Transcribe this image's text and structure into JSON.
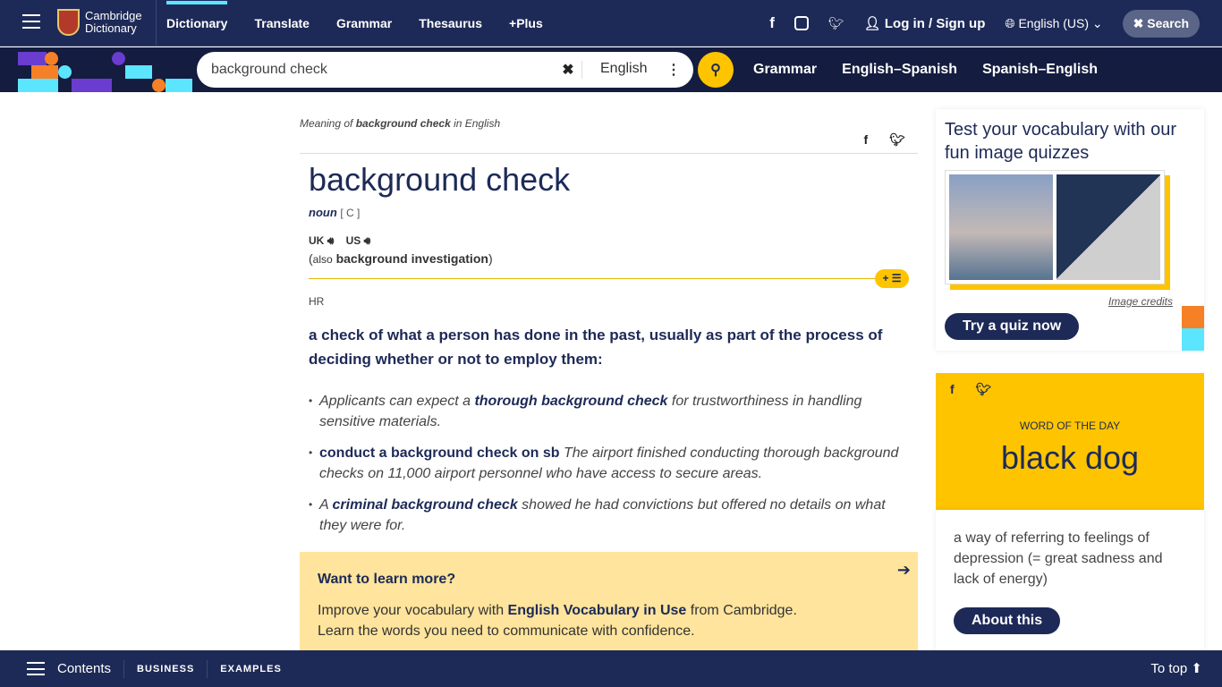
{
  "header": {
    "logo_line1": "Cambridge",
    "logo_line2": "Dictionary",
    "nav": [
      "Dictionary",
      "Translate",
      "Grammar",
      "Thesaurus",
      "+Plus"
    ],
    "login": "Log in / Sign up",
    "language": "English (US)",
    "search_button": "Search"
  },
  "search": {
    "value": "background check",
    "dictionary": "English",
    "links": [
      "Grammar",
      "English–Spanish",
      "Spanish–English"
    ]
  },
  "entry": {
    "meaning_prefix": "Meaning of ",
    "meaning_word": "background check",
    "meaning_suffix": " in English",
    "headword": "background check",
    "pos": "noun",
    "grammar": "[ C ]",
    "uk": "UK",
    "us": "US",
    "also_label": "also",
    "also_word": "background investigation",
    "domain": "HR",
    "definition": "a check of what a person has done in the past, usually as part of the process of deciding whether or not to employ them:",
    "examples": [
      {
        "a": "Applicants can expect a ",
        "b": "thorough background check",
        "c": " for trustworthiness in handling sensitive materials."
      },
      {
        "a": "",
        "b": "conduct a background check on sb",
        "c": " The airport finished conducting thorough background checks on 11,000 airport personnel who have access to secure areas."
      },
      {
        "a": "A ",
        "b": "criminal background check",
        "c": " showed he had convictions but offered no details on what they were for."
      }
    ]
  },
  "learn": {
    "title": "Want to learn more?",
    "p1a": "Improve your vocabulary with ",
    "p1b": "English Vocabulary in Use",
    "p1c": " from Cambridge.",
    "p2": "Learn the words you need to communicate with confidence."
  },
  "quiz": {
    "title": "Test your vocabulary with our fun image quizzes",
    "credits": "Image credits",
    "button": "Try a quiz now"
  },
  "wotd": {
    "label": "WORD OF THE DAY",
    "word": "black dog",
    "definition": "a way of referring to feelings of depression (= great sadness and lack of energy)",
    "button": "About this"
  },
  "footer": {
    "contents": "Contents",
    "items": [
      "BUSINESS",
      "EXAMPLES"
    ],
    "to_top": "To top"
  },
  "colors": {
    "navy": "#1d2a57",
    "yellow": "#fec400",
    "light_yellow": "#fee49c",
    "cyan": "#5be5ff",
    "orange": "#f58025",
    "purple": "#6a3ccf"
  }
}
